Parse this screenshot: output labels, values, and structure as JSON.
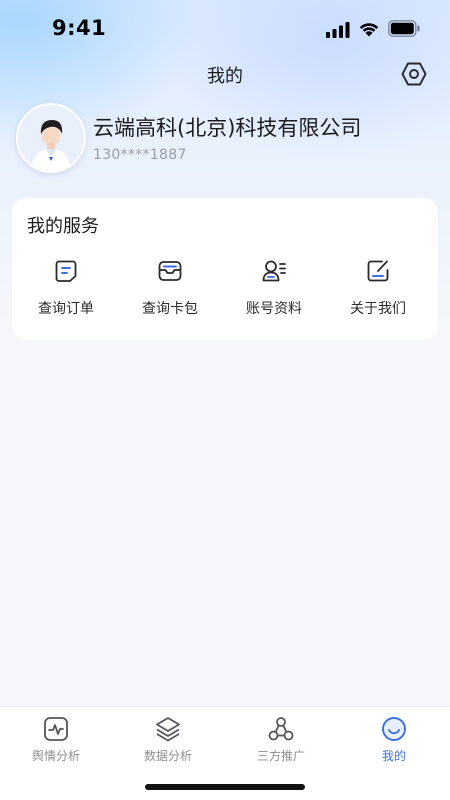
{
  "status_bar": {
    "time": "9:41"
  },
  "nav": {
    "title": "我的",
    "settings_icon": "settings-icon"
  },
  "profile": {
    "company_name": "云端高科(北京)科技有限公司",
    "phone": "130****1887",
    "avatar_icon": "avatar-icon"
  },
  "services": {
    "title": "我的服务",
    "items": [
      {
        "label": "查询订单",
        "icon": "order-document-icon"
      },
      {
        "label": "查询卡包",
        "icon": "card-wallet-icon"
      },
      {
        "label": "账号资料",
        "icon": "account-profile-icon"
      },
      {
        "label": "关于我们",
        "icon": "edit-note-icon"
      }
    ]
  },
  "tab_bar": {
    "active_index": 3,
    "items": [
      {
        "label": "舆情分析",
        "icon": "pulse-monitor-icon"
      },
      {
        "label": "数据分析",
        "icon": "layers-icon"
      },
      {
        "label": "三方推广",
        "icon": "network-icon"
      },
      {
        "label": "我的",
        "icon": "smile-icon"
      }
    ]
  },
  "colors": {
    "accent": "#3d6fe0",
    "inactive": "#8e8e93",
    "card_bg": "#ffffff",
    "page_bg": "#f6f7fa"
  }
}
